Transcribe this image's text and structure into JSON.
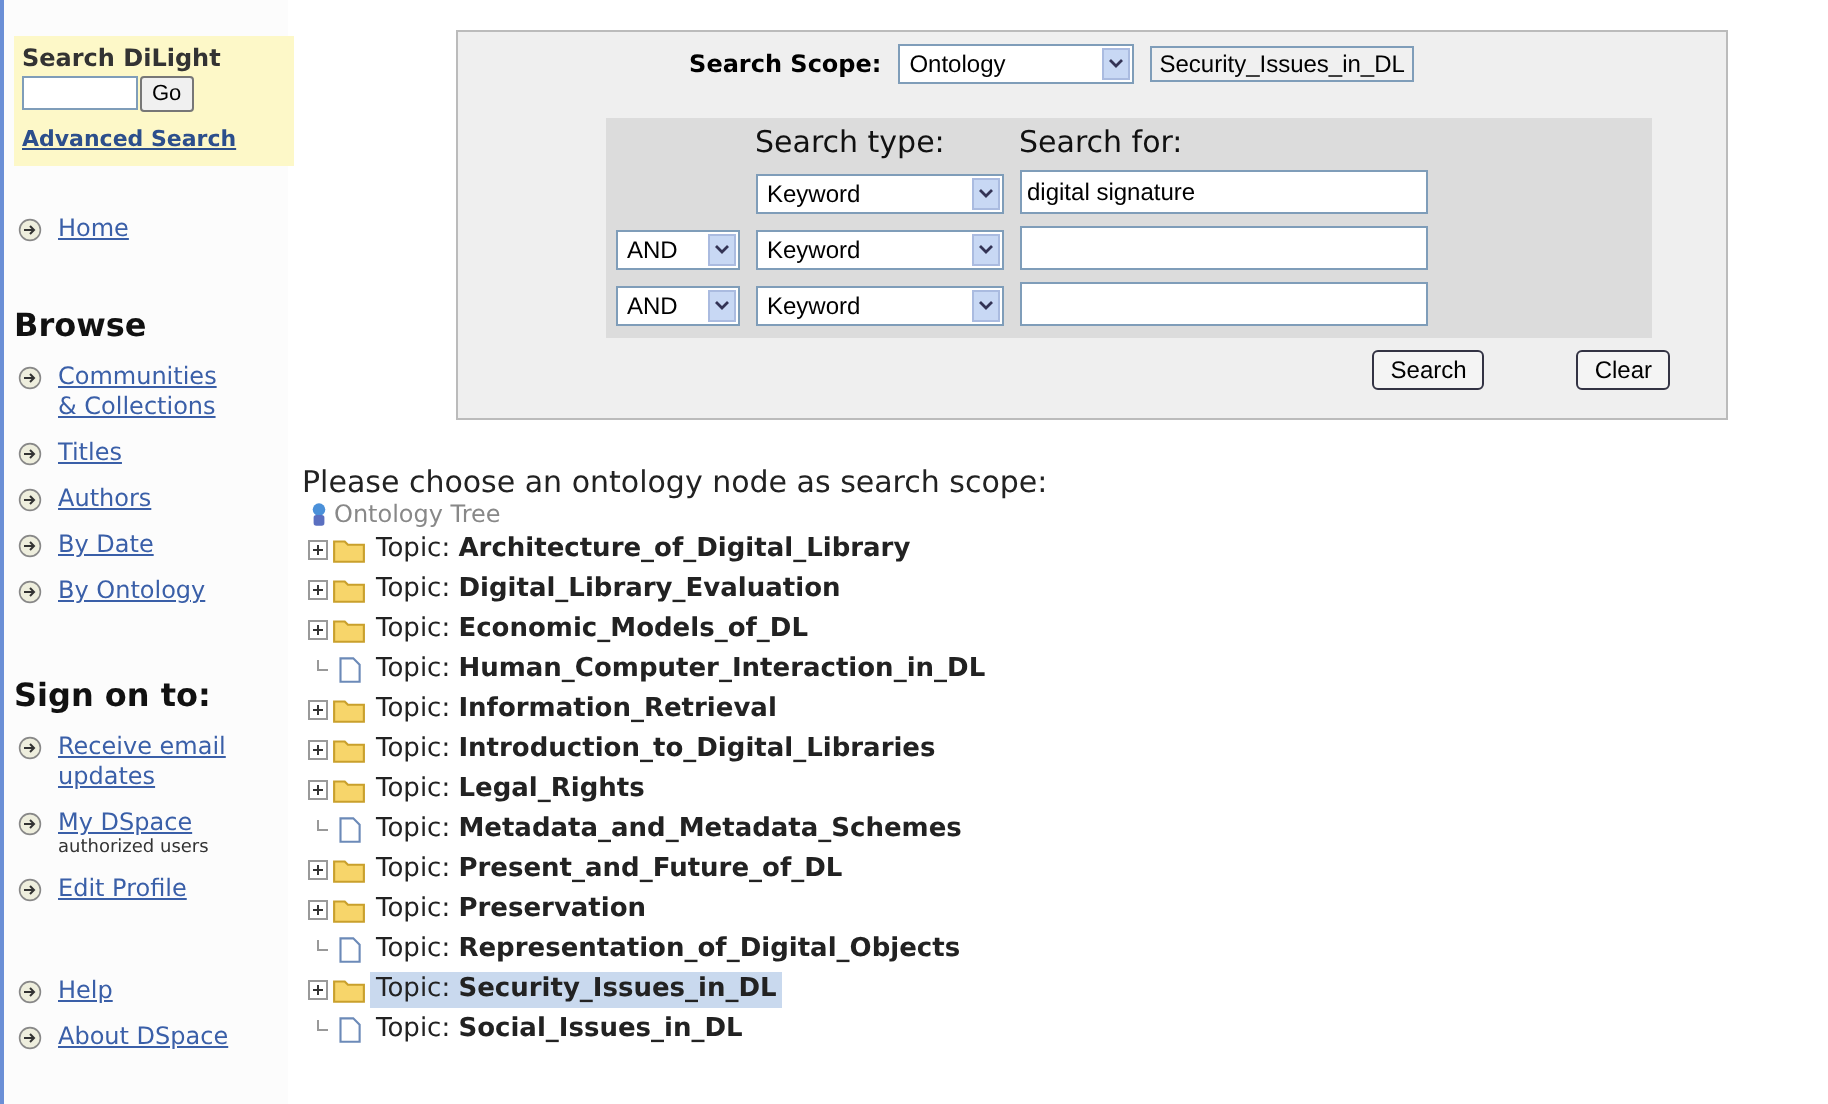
{
  "sidebar": {
    "search": {
      "title": "Search DiLight",
      "button": "Go",
      "advanced": "Advanced Search"
    },
    "home": {
      "label": "Home"
    },
    "browse": {
      "heading": "Browse",
      "items": [
        {
          "label": "Communities & Collections"
        },
        {
          "label": "Titles"
        },
        {
          "label": "Authors"
        },
        {
          "label": "By Date"
        },
        {
          "label": "By Ontology"
        }
      ]
    },
    "sign_on": {
      "heading": "Sign on to:",
      "items": [
        {
          "label": "Receive email updates"
        },
        {
          "label": "My DSpace",
          "note": "authorized users"
        },
        {
          "label": "Edit Profile"
        }
      ]
    },
    "footer_items": [
      {
        "label": "Help"
      },
      {
        "label": "About DSpace"
      }
    ]
  },
  "search_panel": {
    "scope_label": "Search Scope:",
    "scope_select": "Ontology",
    "scope_value": "Security_Issues_in_DL",
    "type_heading": "Search type:",
    "for_heading": "Search for:",
    "rows": [
      {
        "conjunction": null,
        "type": "Keyword",
        "value": "digital signature"
      },
      {
        "conjunction": "AND",
        "type": "Keyword"
      },
      {
        "conjunction": "AND",
        "type": "Keyword"
      }
    ],
    "buttons": [
      "Search",
      "Clear"
    ]
  },
  "tree": {
    "prompt": "Please choose an ontology node as search scope:",
    "root": "Ontology Tree",
    "items": [
      {
        "kind": "folder",
        "text": "Topic: **Architecture_of_Digital_Library**",
        "selected": false
      },
      {
        "kind": "folder",
        "text": "Topic: **Digital_Library_Evaluation**",
        "selected": false
      },
      {
        "kind": "folder",
        "text": "Topic: **Economic_Models_of_DL**",
        "selected": false
      },
      {
        "kind": "leaf",
        "text": "Topic: **Human_Computer_Interaction_in_DL**",
        "selected": false
      },
      {
        "kind": "folder",
        "text": "Topic: **Information_Retrieval**",
        "selected": false
      },
      {
        "kind": "folder",
        "text": "Topic: **Introduction_to_Digital_Libraries**",
        "selected": false
      },
      {
        "kind": "folder",
        "text": "Topic: **Legal_Rights**",
        "selected": false
      },
      {
        "kind": "leaf",
        "text": "Topic: **Metadata_and_Metadata_Schemes**",
        "selected": false
      },
      {
        "kind": "folder",
        "text": "Topic: **Present_and_Future_of_DL**",
        "selected": false
      },
      {
        "kind": "folder",
        "text": "Topic: **Preservation**",
        "selected": false
      },
      {
        "kind": "leaf",
        "text": "Topic: **Representation_of_Digital_Objects**",
        "selected": false
      },
      {
        "kind": "folder",
        "text": "Topic: **Security_Issues_in_DL**",
        "selected": true
      },
      {
        "kind": "leaf",
        "text": "Topic: **Social_Issues_in_DL**",
        "selected": false
      }
    ]
  }
}
